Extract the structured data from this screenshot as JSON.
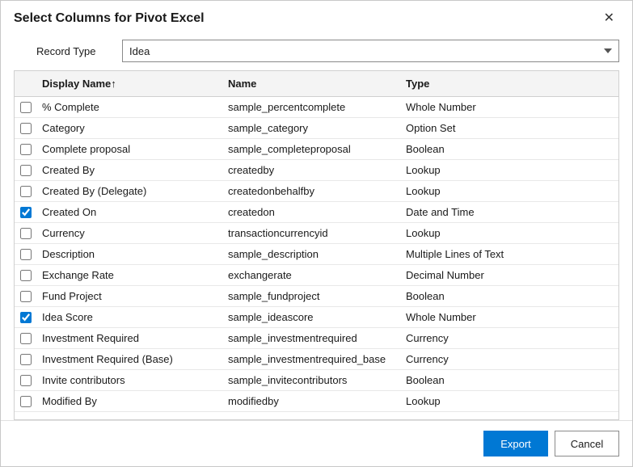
{
  "dialog": {
    "title": "Select Columns for Pivot Excel",
    "close_label": "✕"
  },
  "record_type": {
    "label": "Record Type",
    "value": "Idea",
    "options": [
      "Idea"
    ]
  },
  "table": {
    "columns": [
      {
        "key": "checkbox",
        "label": ""
      },
      {
        "key": "display_name",
        "label": "Display Name↑"
      },
      {
        "key": "name",
        "label": "Name"
      },
      {
        "key": "type",
        "label": "Type"
      }
    ],
    "rows": [
      {
        "checked": false,
        "display_name": "% Complete",
        "name": "sample_percentcomplete",
        "type": "Whole Number"
      },
      {
        "checked": false,
        "display_name": "Category",
        "name": "sample_category",
        "type": "Option Set"
      },
      {
        "checked": false,
        "display_name": "Complete proposal",
        "name": "sample_completeproposal",
        "type": "Boolean"
      },
      {
        "checked": false,
        "display_name": "Created By",
        "name": "createdby",
        "type": "Lookup"
      },
      {
        "checked": false,
        "display_name": "Created By (Delegate)",
        "name": "createdonbehalfby",
        "type": "Lookup"
      },
      {
        "checked": true,
        "display_name": "Created On",
        "name": "createdon",
        "type": "Date and Time"
      },
      {
        "checked": false,
        "display_name": "Currency",
        "name": "transactioncurrencyid",
        "type": "Lookup"
      },
      {
        "checked": false,
        "display_name": "Description",
        "name": "sample_description",
        "type": "Multiple Lines of Text"
      },
      {
        "checked": false,
        "display_name": "Exchange Rate",
        "name": "exchangerate",
        "type": "Decimal Number"
      },
      {
        "checked": false,
        "display_name": "Fund Project",
        "name": "sample_fundproject",
        "type": "Boolean"
      },
      {
        "checked": true,
        "display_name": "Idea Score",
        "name": "sample_ideascore",
        "type": "Whole Number"
      },
      {
        "checked": false,
        "display_name": "Investment Required",
        "name": "sample_investmentrequired",
        "type": "Currency"
      },
      {
        "checked": false,
        "display_name": "Investment Required (Base)",
        "name": "sample_investmentrequired_base",
        "type": "Currency"
      },
      {
        "checked": false,
        "display_name": "Invite contributors",
        "name": "sample_invitecontributors",
        "type": "Boolean"
      },
      {
        "checked": false,
        "display_name": "Modified By",
        "name": "modifiedby",
        "type": "Lookup"
      }
    ]
  },
  "footer": {
    "export_label": "Export",
    "cancel_label": "Cancel"
  }
}
